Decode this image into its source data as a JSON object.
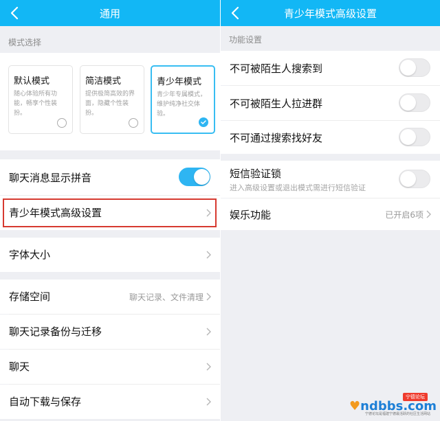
{
  "left": {
    "header": {
      "title": "通用",
      "back_icon": "chevron-left-icon"
    },
    "mode_section_label": "模式选择",
    "modes": [
      {
        "title": "默认模式",
        "desc": "随心体验所有功能，畅享个性装扮。",
        "selected": false
      },
      {
        "title": "简洁模式",
        "desc": "提供极简高效的界面，隐藏个性装扮。",
        "selected": false
      },
      {
        "title": "青少年模式",
        "desc": "青少年专属模式，维护纯净社交体验。",
        "selected": true
      }
    ],
    "pinyin_row": {
      "label": "聊天消息显示拼音",
      "toggle_on": true
    },
    "teen_settings_row": {
      "label": "青少年模式高级设置"
    },
    "font_size_row": {
      "label": "字体大小"
    },
    "storage_row": {
      "label": "存储空间",
      "hint": "聊天记录、文件清理"
    },
    "backup_row": {
      "label": "聊天记录备份与迁移"
    },
    "chat_row": {
      "label": "聊天"
    },
    "autodownload_row": {
      "label": "自动下载与保存"
    }
  },
  "right": {
    "header": {
      "title": "青少年模式高级设置",
      "back_icon": "chevron-left-icon"
    },
    "function_section_label": "功能设置",
    "toggles": [
      {
        "label": "不可被陌生人搜索到",
        "on": false
      },
      {
        "label": "不可被陌生人拉进群",
        "on": false
      },
      {
        "label": "不可通过搜索找好友",
        "on": false
      }
    ],
    "sms_lock": {
      "label": "短信验证锁",
      "sub": "进入高级设置或退出模式需进行短信验证",
      "on": false
    },
    "entertainment": {
      "label": "娱乐功能",
      "hint": "已开启6项"
    }
  },
  "watermark": {
    "main": "ndbbs.com",
    "tag": "宁德论坛",
    "sub": "宁德论坛是福建宁德最活跃的社区生活网站"
  },
  "colors": {
    "accent": "#12b7f5",
    "toggle_on": "#2eb5f2",
    "highlight": "#d6392f",
    "background": "#eeeff3"
  }
}
